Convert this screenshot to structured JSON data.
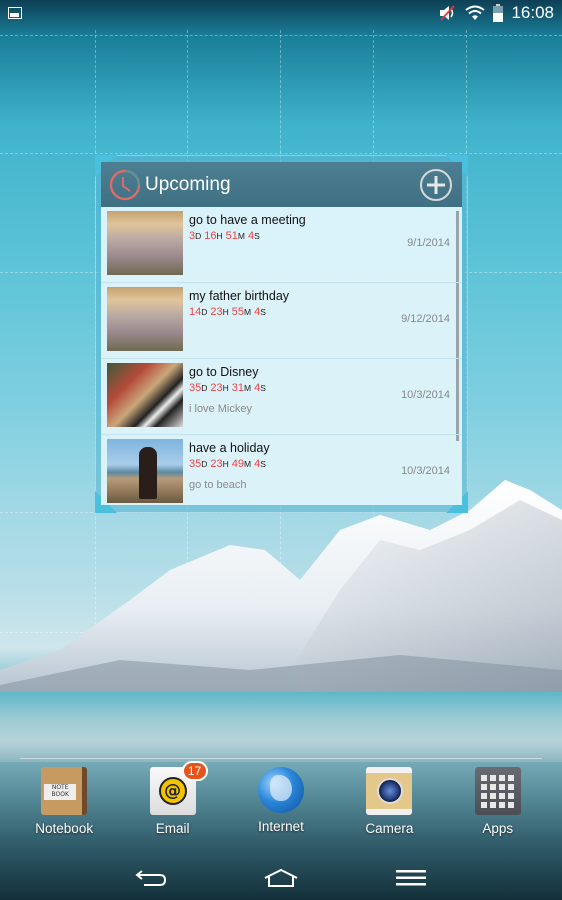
{
  "status_bar": {
    "notification_icon": "gallery-icon",
    "icons": [
      "volume-muted-icon",
      "wifi-icon",
      "battery-icon"
    ],
    "time": "16:08"
  },
  "widget": {
    "title": "Upcoming",
    "header_icon": "clock-icon",
    "add_icon": "add-circle-icon",
    "accent_color": "#ee4444",
    "events": [
      {
        "title": "go to have a meeting",
        "thumbnail": "beach-pebbles-photo",
        "countdown": {
          "days": "3",
          "hours": "16",
          "minutes": "51",
          "seconds": "4"
        },
        "note": "",
        "date": "9/1/2014"
      },
      {
        "title": "my father birthday",
        "thumbnail": "beach-pebbles-photo",
        "countdown": {
          "days": "14",
          "hours": "23",
          "minutes": "55",
          "seconds": "4"
        },
        "note": "",
        "date": "9/12/2014"
      },
      {
        "title": "go to Disney",
        "thumbnail": "disney-character-photo",
        "countdown": {
          "days": "35",
          "hours": "23",
          "minutes": "31",
          "seconds": "4"
        },
        "note": "i love Mickey",
        "date": "10/3/2014"
      },
      {
        "title": "have a holiday",
        "thumbnail": "dog-on-beach-photo",
        "countdown": {
          "days": "35",
          "hours": "23",
          "minutes": "49",
          "seconds": "4"
        },
        "note": "go to beach",
        "date": "10/3/2014"
      }
    ],
    "units": {
      "days": "D",
      "hours": "H",
      "minutes": "M",
      "seconds": "S"
    }
  },
  "dock": {
    "apps": [
      {
        "label": "Notebook",
        "icon": "notebook-icon",
        "icon_text": "NOTE BOOK"
      },
      {
        "label": "Email",
        "icon": "email-icon",
        "badge": "17",
        "icon_text": "@"
      },
      {
        "label": "Internet",
        "icon": "globe-icon"
      },
      {
        "label": "Camera",
        "icon": "camera-icon"
      },
      {
        "label": "Apps",
        "icon": "apps-grid-icon"
      }
    ]
  },
  "nav_bar": {
    "buttons": [
      "back-icon",
      "home-icon",
      "menu-icon"
    ]
  }
}
